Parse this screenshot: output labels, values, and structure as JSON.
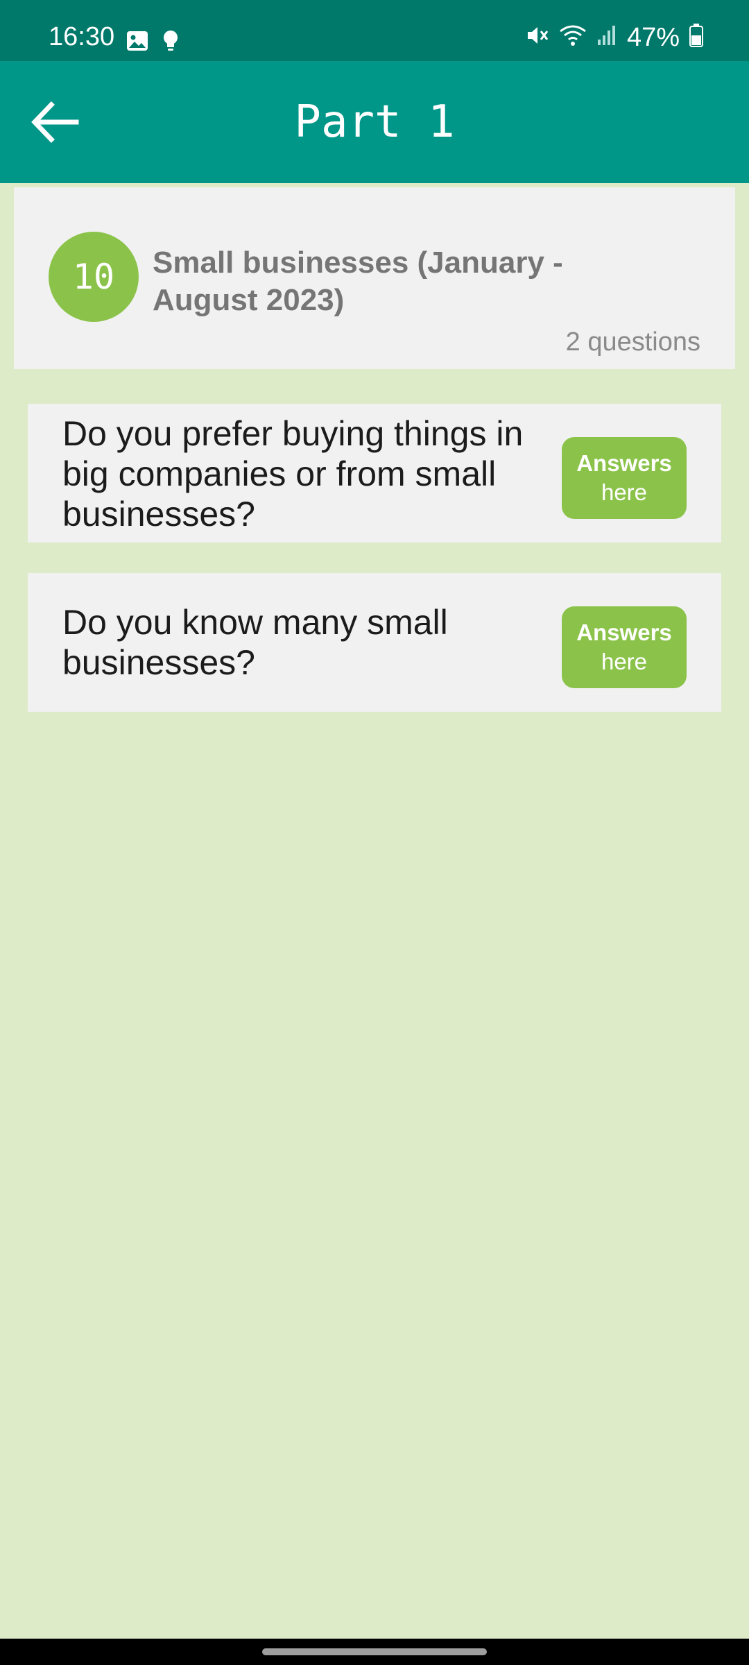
{
  "status_bar": {
    "time": "16:30",
    "battery_percent": "47%",
    "icons_left": [
      "image-icon",
      "bulb-icon"
    ],
    "icons_right": [
      "mute-icon",
      "wifi-icon",
      "signal-icon",
      "battery-icon"
    ]
  },
  "app_bar": {
    "title": "Part 1",
    "back_icon": "arrow-left-icon"
  },
  "topic": {
    "number": "10",
    "title": "Small businesses (January - August 2023)",
    "question_count": "2 questions"
  },
  "questions": [
    {
      "text": "Do you prefer buying things in big companies or from small businesses?",
      "button_top": "Answers",
      "button_bottom": "here"
    },
    {
      "text": "Do you know many small businesses?",
      "button_top": "Answers",
      "button_bottom": "here"
    }
  ],
  "colors": {
    "status_bar": "#00796b",
    "app_bar": "#009688",
    "background": "#deebc8",
    "card": "#f1f1f1",
    "accent": "#8bc34a"
  }
}
